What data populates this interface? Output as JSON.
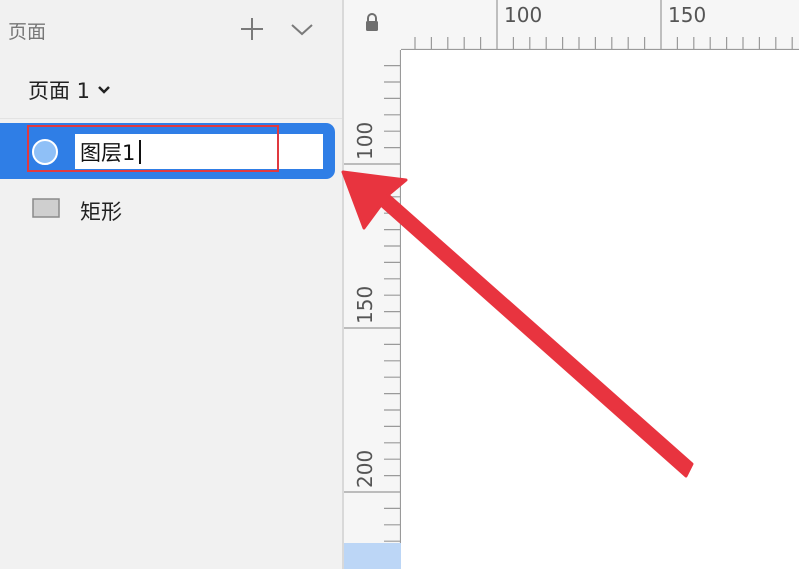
{
  "sidebar": {
    "title": "页面",
    "current_page": "页面 1",
    "layers": [
      {
        "name": "图层1",
        "type": "oval",
        "selected": true,
        "editing": true
      },
      {
        "name": "矩形",
        "type": "rectangle",
        "selected": false
      }
    ]
  },
  "rulers": {
    "horizontal_labels": [
      "100",
      "150"
    ],
    "vertical_labels": [
      "100",
      "150",
      "200"
    ]
  },
  "icons": {
    "add": "plus-icon",
    "collapse": "chevron-down-icon",
    "page_menu": "chevron-down-icon",
    "lock": "lock-icon",
    "oval_layer": "circle-icon",
    "rectangle_layer": "rectangle-icon"
  },
  "colors": {
    "selection_blue": "#2f7ee6",
    "annotation_red": "#e8343f",
    "panel_bg": "#f1f1f1",
    "ruler_bg": "#f6f6f6"
  }
}
